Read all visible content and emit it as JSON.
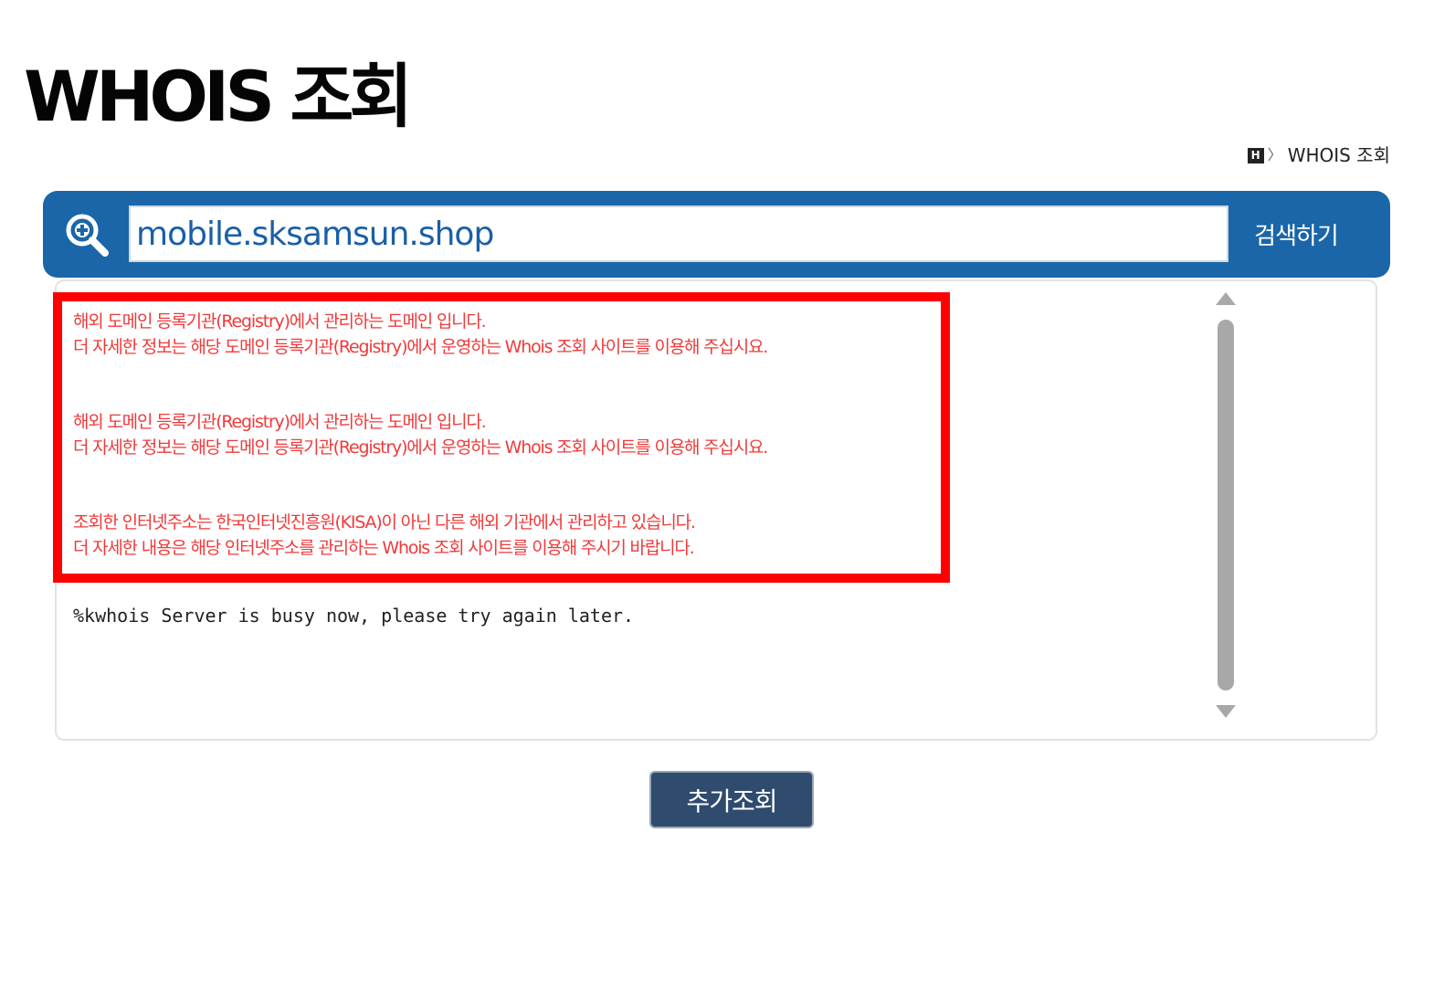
{
  "header": {
    "title": "WHOIS 조회"
  },
  "breadcrumb": {
    "home_icon_label": "H",
    "separator": "〉",
    "current": "WHOIS 조회"
  },
  "search": {
    "value": "mobile.sksamsun.shop",
    "button_label": "검색하기"
  },
  "notices": [
    {
      "line1": "해외 도메인 등록기관(Registry)에서 관리하는 도메인 입니다.",
      "line2": "더 자세한 정보는 해당 도메인 등록기관(Registry)에서 운영하는 Whois 조회 사이트를 이용해 주십시요."
    },
    {
      "line1": "해외 도메인 등록기관(Registry)에서 관리하는 도메인 입니다.",
      "line2": "더 자세한 정보는 해당 도메인 등록기관(Registry)에서 운영하는 Whois 조회 사이트를 이용해 주십시요."
    },
    {
      "line1": "조회한 인터넷주소는 한국인터넷진흥원(KISA)이 아닌 다른 해외 기관에서 관리하고 있습니다.",
      "line2": "더 자세한 내용은 해당 인터넷주소를 관리하는 Whois 조회 사이트를 이용해 주시기 바랍니다."
    }
  ],
  "response_text": "%kwhois Server is busy now, please try again later.",
  "more_button_label": "추가조회",
  "colors": {
    "search_bar_bg": "#1a66a8",
    "notice_text": "#f03a3a",
    "highlight_border": "#ff0000",
    "more_button_bg": "#2f4b6e"
  }
}
